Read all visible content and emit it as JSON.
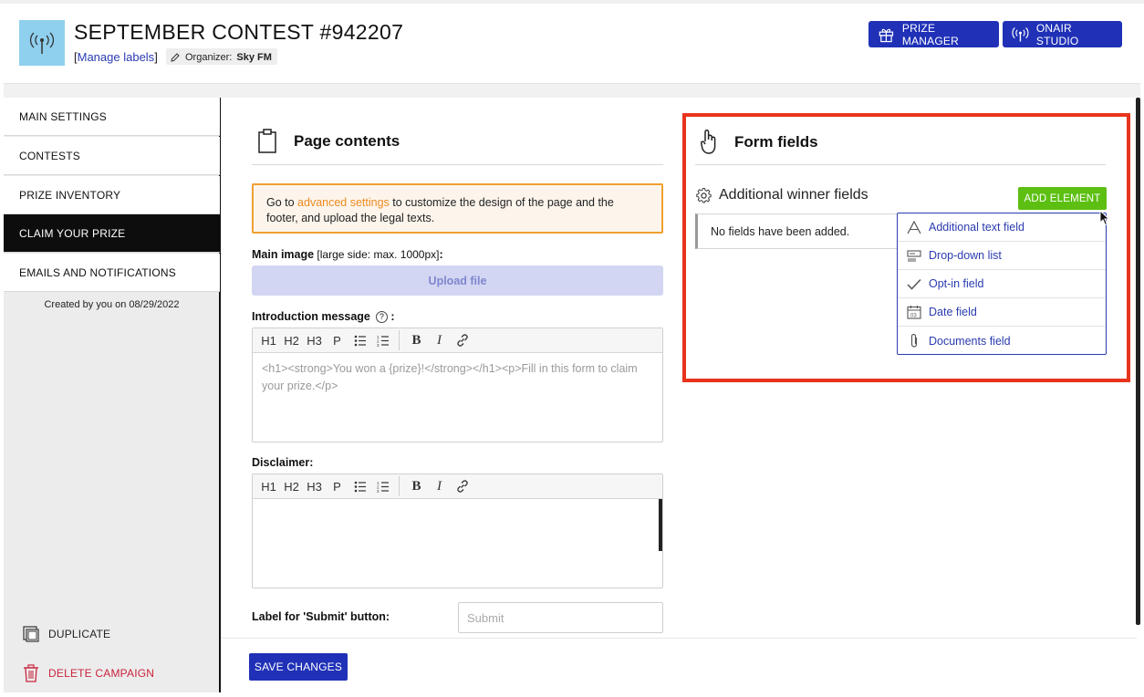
{
  "header": {
    "title": "SEPTEMBER CONTEST #942207",
    "manage_labels": "Manage labels",
    "organizer_prefix": "Organizer:",
    "organizer_name": "Sky FM",
    "prize_manager": "PRIZE MANAGER",
    "onair_studio": "ONAIR STUDIO"
  },
  "sidebar": {
    "items": [
      {
        "label": "MAIN SETTINGS"
      },
      {
        "label": "CONTESTS"
      },
      {
        "label": "PRIZE INVENTORY"
      },
      {
        "label": "CLAIM YOUR PRIZE"
      },
      {
        "label": "EMAILS AND NOTIFICATIONS"
      }
    ],
    "active": "CLAIM YOUR PRIZE",
    "created": "Created by you on 08/29/2022",
    "duplicate": "DUPLICATE",
    "delete": "DELETE CAMPAIGN"
  },
  "page_contents": {
    "title": "Page contents",
    "notice_before": "Go to ",
    "notice_link": "advanced settings",
    "notice_after": " to customize the design of the page and the footer, and upload the legal texts.",
    "main_image_label": "Main image",
    "main_image_note": " [large side: max. 1000px]",
    "main_image_colon": ":",
    "upload_file": "Upload file",
    "intro_label": "Introduction message",
    "intro_colon": ":",
    "intro_value": "<h1><strong>You won a {prize}!</strong></h1><p>Fill in this form to claim your prize.</p>",
    "disclaimer_label": "Disclaimer:",
    "disclaimer_value": "",
    "submit_label": "Label for 'Submit' button:",
    "submit_placeholder": "Submit",
    "save_changes": "SAVE CHANGES",
    "toolbar": {
      "h1": "H1",
      "h2": "H2",
      "h3": "H3",
      "p": "P",
      "b": "B",
      "i": "I"
    }
  },
  "form_fields": {
    "title": "Form fields",
    "section": "Additional winner fields",
    "add_element": "ADD ELEMENT",
    "empty": "No fields have been added.",
    "menu": [
      {
        "label": "Additional text field",
        "icon": "text-field-icon"
      },
      {
        "label": "Drop-down list",
        "icon": "dropdown-list-icon"
      },
      {
        "label": "Opt-in field",
        "icon": "checkmark-icon"
      },
      {
        "label": "Date field",
        "icon": "calendar-icon"
      },
      {
        "label": "Documents field",
        "icon": "paperclip-icon"
      }
    ]
  },
  "colors": {
    "primary": "#2031b7",
    "accent_green": "#5cbf12",
    "highlight_red": "#e8341c",
    "notice_orange": "#f0a030",
    "danger": "#c9243c"
  }
}
